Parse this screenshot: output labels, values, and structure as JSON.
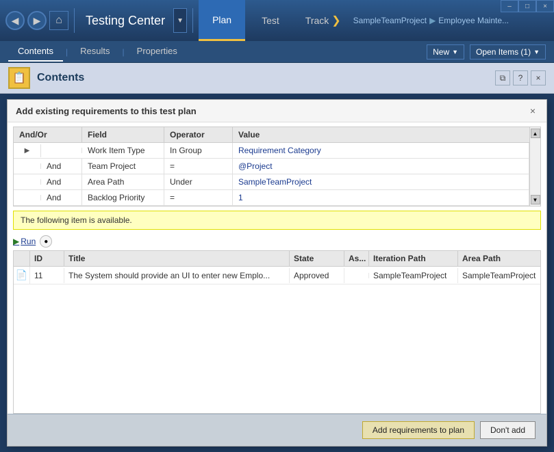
{
  "window": {
    "controls": {
      "minimize": "–",
      "maximize": "□",
      "close": "×"
    }
  },
  "titlebar": {
    "back_label": "◀",
    "forward_label": "▶",
    "home_label": "⌂",
    "app_title": "Testing Center",
    "dropdown_label": "▼",
    "plan_tab": "Plan",
    "test_tab": "Test",
    "track_label": "Track",
    "track_arrow": "❯",
    "breadcrumb": {
      "project": "SampleTeamProject",
      "sep1": "▶",
      "page": "Employee Mainte..."
    }
  },
  "toolbar": {
    "tabs": [
      {
        "label": "Contents",
        "active": true
      },
      {
        "label": "Results",
        "active": false
      },
      {
        "label": "Properties",
        "active": false
      }
    ],
    "new_label": "New",
    "new_arrow": "▼",
    "open_items_label": "Open Items (1)",
    "open_items_arrow": "▼"
  },
  "content_header": {
    "title": "Contents",
    "icon_label": "📋",
    "actions": {
      "export": "⧉",
      "help": "?",
      "close": "×"
    }
  },
  "dialog": {
    "title": "Add existing requirements to this test plan",
    "close_label": "×",
    "query": {
      "columns": [
        "And/Or",
        "Field",
        "Operator",
        "Value"
      ],
      "rows": [
        {
          "andor": "",
          "field": "Work Item Type",
          "operator": "In Group",
          "value": "Requirement Category",
          "arrow": true
        },
        {
          "andor": "And",
          "field": "Team Project",
          "operator": "=",
          "value": "@Project"
        },
        {
          "andor": "And",
          "field": "Area Path",
          "operator": "Under",
          "value": "SampleTeamProject"
        },
        {
          "andor": "And",
          "field": "Backlog Priority",
          "operator": "=",
          "value": "1"
        }
      ]
    },
    "notice": "The following item is available.",
    "run_label": "Run",
    "run_icon": "▶",
    "results": {
      "columns": [
        "",
        "ID",
        "Title",
        "State",
        "As...",
        "Iteration Path",
        "Area Path"
      ],
      "rows": [
        {
          "icon": "📄",
          "id": "11",
          "title": "The System should provide an UI to enter new Emplo...",
          "state": "Approved",
          "assigned": "",
          "iteration": "SampleTeamProject",
          "area": "SampleTeamProject"
        }
      ]
    },
    "add_btn": "Add requirements to plan",
    "dont_btn": "Don't add"
  }
}
